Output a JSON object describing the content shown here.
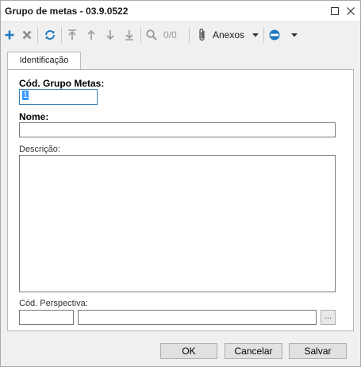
{
  "window": {
    "title": "Grupo de metas - 03.9.0522"
  },
  "toolbar": {
    "items": [
      {
        "icon": "plus-icon"
      },
      {
        "icon": "delete-icon"
      },
      {
        "icon": "refresh-icon"
      },
      {
        "icon": "move-first-icon"
      },
      {
        "icon": "move-up-icon"
      },
      {
        "icon": "move-down-icon"
      },
      {
        "icon": "move-last-icon"
      },
      {
        "icon": "search-icon"
      }
    ],
    "count": "0/0",
    "anexos_label": "Anexos"
  },
  "tabs": [
    {
      "label": "Identificação"
    }
  ],
  "form": {
    "cod_grupo_label": "Cód. Grupo Metas:",
    "cod_grupo_value": "1",
    "nome_label": "Nome:",
    "nome_value": "",
    "descricao_label": "Descrição:",
    "descricao_value": "",
    "perspectiva_label": "Cód. Perspectiva:",
    "perspectiva_code": "",
    "perspectiva_desc": "",
    "ellipsis_label": "..."
  },
  "buttons": {
    "ok": "OK",
    "cancel": "Cancelar",
    "save": "Salvar"
  },
  "colors": {
    "accent": "#1f7bc1",
    "disabled": "#9a9a9a",
    "focus_border": "#3c7fb1"
  }
}
